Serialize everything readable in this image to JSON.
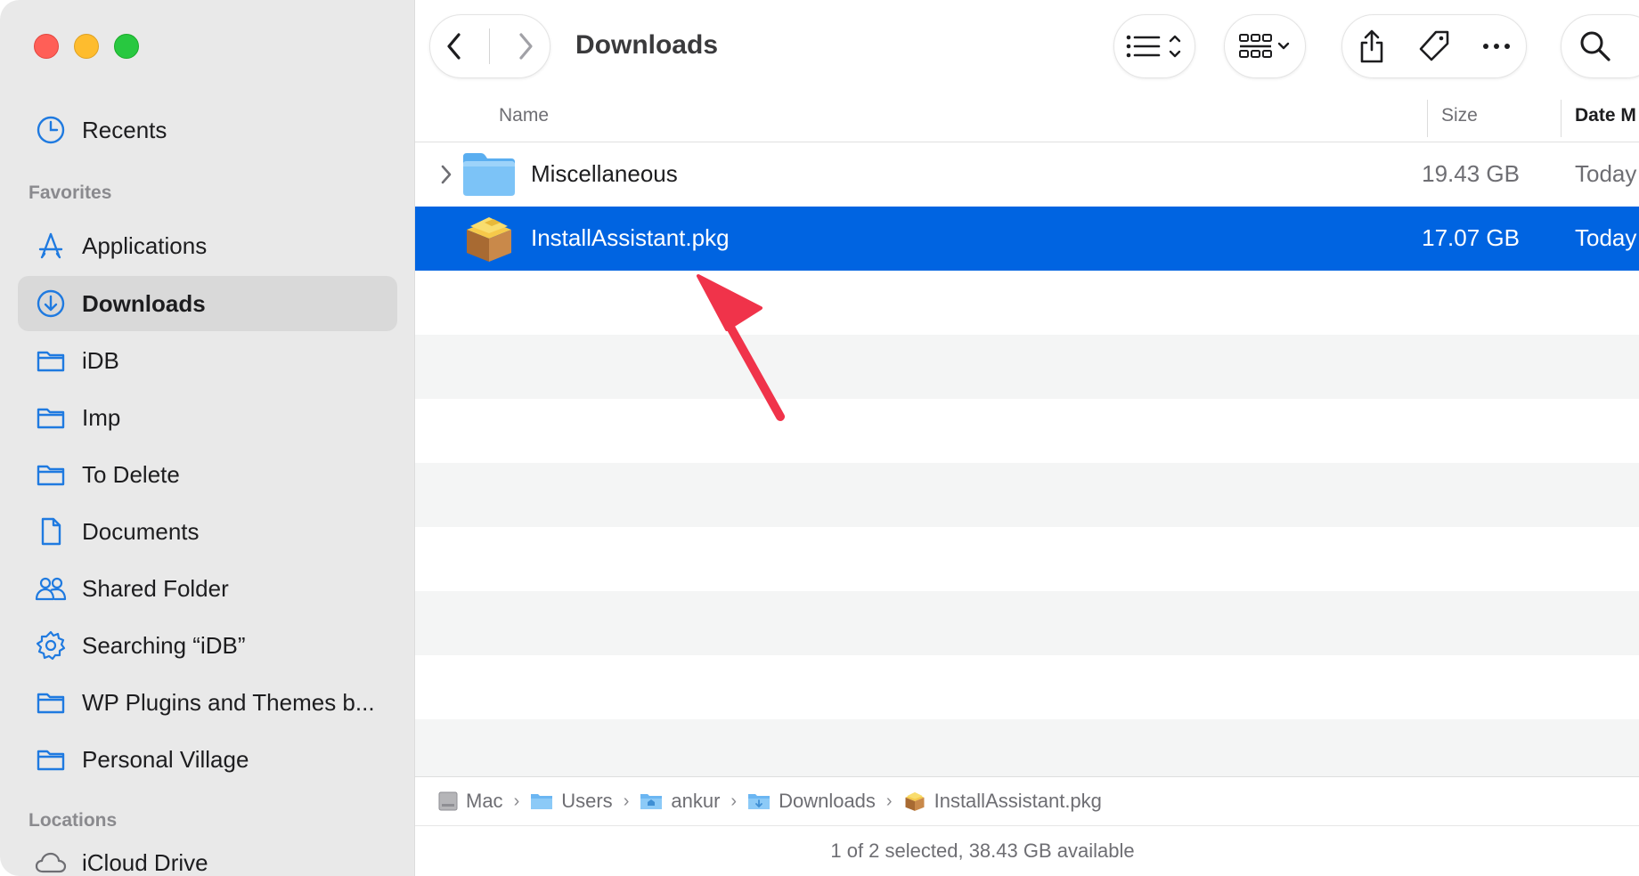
{
  "window": {
    "title": "Downloads"
  },
  "sidebar": {
    "recents_label": "Recents",
    "favorites_header": "Favorites",
    "favorites": [
      {
        "label": "Applications",
        "icon": "applications-icon"
      },
      {
        "label": "Downloads",
        "icon": "downloads-icon",
        "active": true
      },
      {
        "label": "iDB",
        "icon": "folder-icon"
      },
      {
        "label": "Imp",
        "icon": "folder-icon"
      },
      {
        "label": "To Delete",
        "icon": "folder-icon"
      },
      {
        "label": "Documents",
        "icon": "document-icon"
      },
      {
        "label": "Shared Folder",
        "icon": "shared-folder-icon"
      },
      {
        "label": "Searching “iDB”",
        "icon": "gear-icon"
      },
      {
        "label": "WP Plugins and Themes b...",
        "icon": "folder-icon"
      },
      {
        "label": "Personal Village",
        "icon": "folder-icon"
      }
    ],
    "locations_header": "Locations",
    "locations": [
      {
        "label": "iCloud Drive",
        "icon": "icloud-icon"
      }
    ]
  },
  "columns": {
    "name": "Name",
    "size": "Size",
    "date": "Date M"
  },
  "files": [
    {
      "name": "Miscellaneous",
      "size": "19.43 GB",
      "date": "Today",
      "kind": "folder",
      "selected": false
    },
    {
      "name": "InstallAssistant.pkg",
      "size": "17.07 GB",
      "date": "Today",
      "kind": "package",
      "selected": true
    }
  ],
  "pathbar": [
    {
      "label": "Mac",
      "icon": "disk-icon"
    },
    {
      "label": "Users",
      "icon": "folder-icon"
    },
    {
      "label": "ankur",
      "icon": "home-folder-icon"
    },
    {
      "label": "Downloads",
      "icon": "downloads-folder-icon"
    },
    {
      "label": "InstallAssistant.pkg",
      "icon": "package-icon"
    }
  ],
  "status": {
    "text": "1 of 2 selected, 38.43 GB available"
  },
  "colors": {
    "accent": "#0064e1",
    "sidebar_icon": "#1f7ae0",
    "arrow": "#f0334a"
  }
}
